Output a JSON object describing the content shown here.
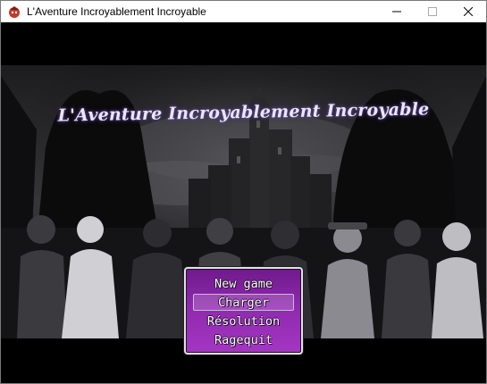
{
  "window": {
    "title": "L'Aventure Incroyablement Incroyable",
    "app_icon": "game-app-icon",
    "controls": [
      {
        "name": "minimize-icon"
      },
      {
        "name": "maximize-icon"
      },
      {
        "name": "close-icon"
      }
    ]
  },
  "game": {
    "title": "L'Aventure Incroyablement Incroyable",
    "menu": {
      "items": [
        "New game",
        "Charger",
        "Résolution",
        "Ragequit"
      ],
      "selected_index": 1,
      "colors": {
        "panel_top": "#6f1a8c",
        "panel_bottom": "#a436c2",
        "border": "#e2e2e2"
      }
    }
  }
}
